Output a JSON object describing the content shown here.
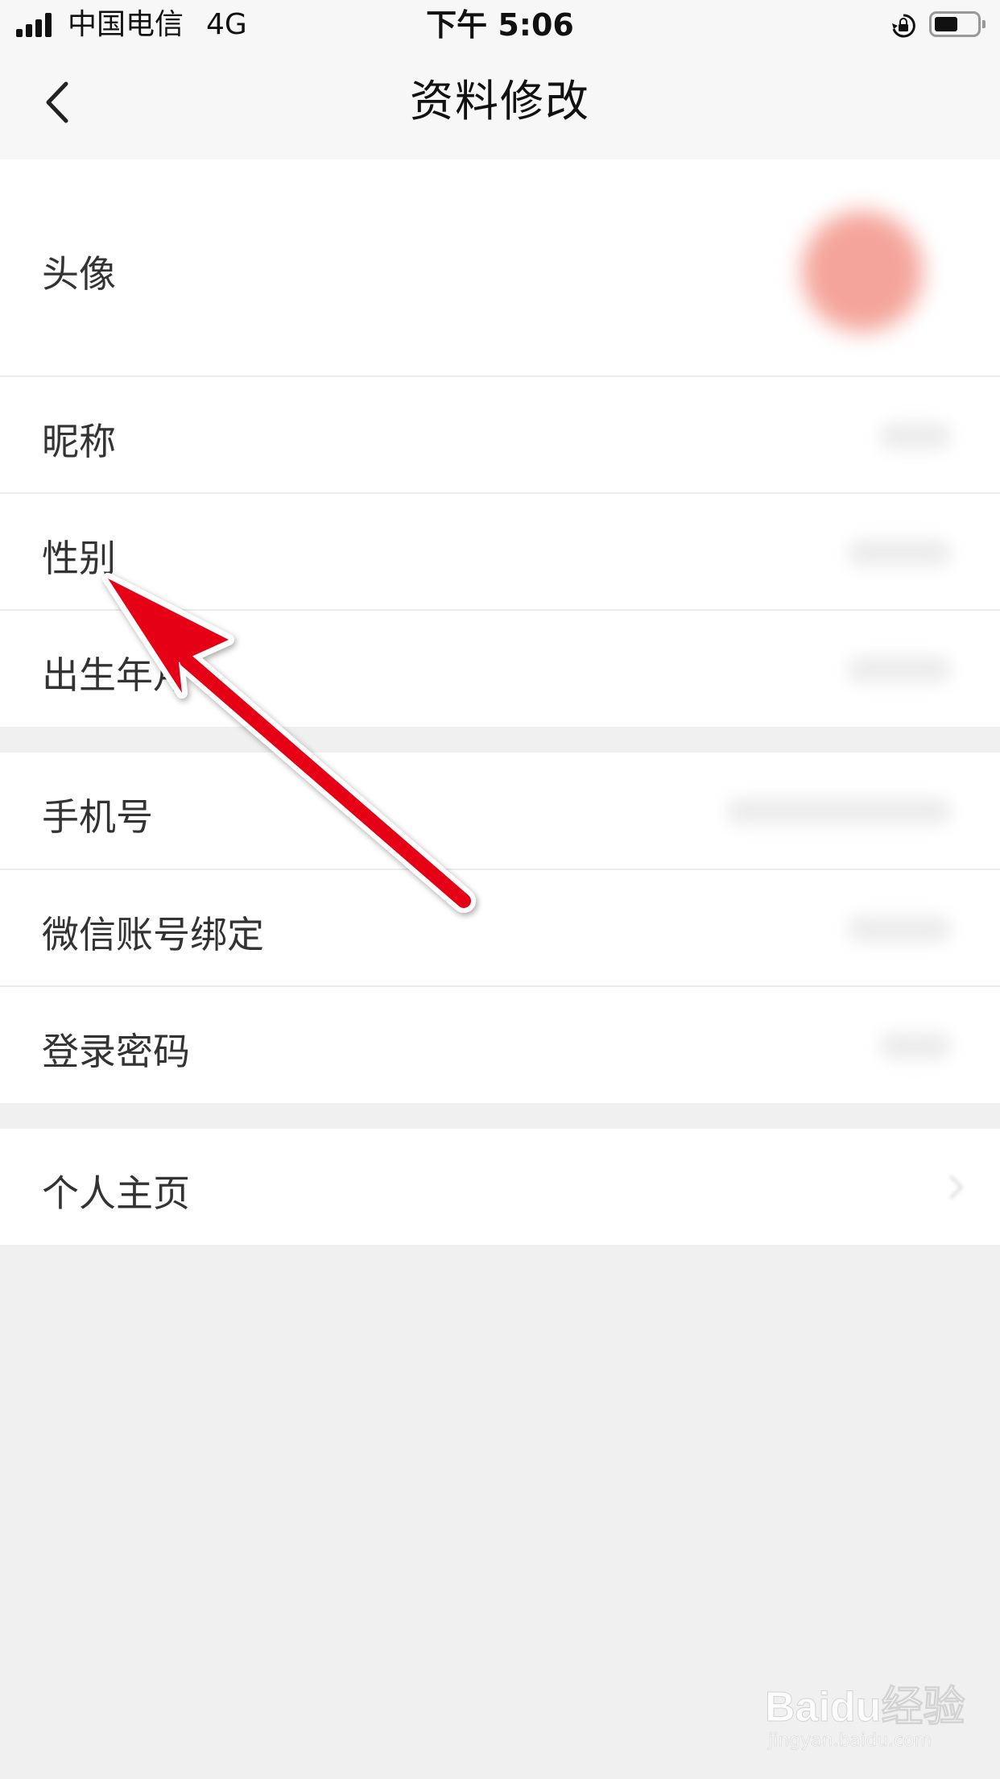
{
  "status_bar": {
    "carrier": "中国电信",
    "network": "4G",
    "time": "下午 5:06"
  },
  "nav": {
    "title": "资料修改"
  },
  "rows": {
    "avatar": "头像",
    "nickname": "昵称",
    "gender": "性别",
    "birth_month": "出生年月",
    "phone": "手机号",
    "wechat_binding": "微信账号绑定",
    "login_password": "登录密码",
    "homepage": "个人主页"
  },
  "colors": {
    "annotation_arrow": "#e60012",
    "avatar": "#f4a59b",
    "page_background": "#f0f0f0"
  },
  "watermark": {
    "logo": "Baidu经验",
    "url": "jingyan.baidu.com"
  }
}
